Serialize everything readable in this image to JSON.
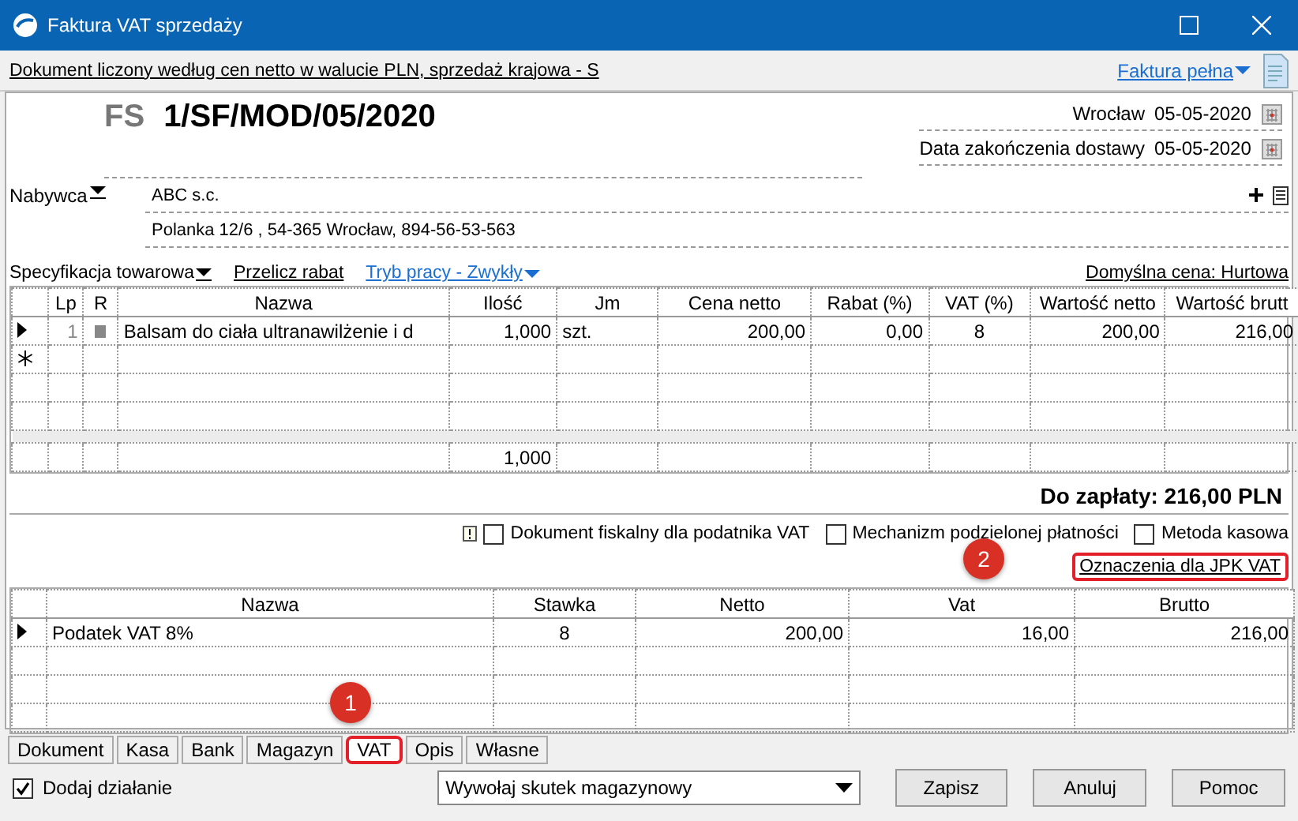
{
  "window": {
    "title": "Faktura VAT sprzedaży"
  },
  "info_bar": {
    "text": "Dokument liczony według cen netto w walucie PLN, sprzedaż krajowa - S",
    "invoice_type": "Faktura pełna"
  },
  "document": {
    "type": "FS",
    "number": "1/SF/MOD/05/2020",
    "place": "Wrocław",
    "issue_date": "05-05-2020",
    "delivery_label": "Data zakończenia dostawy",
    "delivery_date": "05-05-2020"
  },
  "buyer": {
    "label": "Nabywca",
    "name": "ABC s.c.",
    "address": "Polanka  12/6 , 54-365 Wrocław, 894-56-53-563"
  },
  "toolbar": {
    "specification": "Specyfikacja towarowa",
    "recalc": "Przelicz rabat",
    "mode": "Tryb pracy - Zwykły",
    "default_price": "Domyślna cena: Hurtowa"
  },
  "items_table": {
    "columns": [
      "Lp",
      "R",
      "Nazwa",
      "Ilość",
      "Jm",
      "Cena netto",
      "Rabat (%)",
      "VAT (%)",
      "Wartość netto",
      "Wartość brutt"
    ],
    "rows": [
      {
        "current": true,
        "cells": [
          "1",
          "",
          "Balsam do ciała ultranawilżenie i d",
          "1,000",
          "szt.",
          "200,00",
          "0,00",
          "8",
          "200,00",
          "216,00"
        ]
      }
    ],
    "totals": {
      "quantity": "1,000"
    }
  },
  "total": "Do zapłaty: 216,00 PLN",
  "options": [
    {
      "label": "Dokument fiskalny dla podatnika VAT",
      "checked": false,
      "kind": "noted"
    },
    {
      "label": "Mechanizm podzielonej płatności",
      "checked": false,
      "kind": "plain"
    },
    {
      "label": "Metoda kasowa",
      "checked": false,
      "kind": "plain"
    }
  ],
  "jpk_button": {
    "label": "Oznaczenia dla JPK VAT",
    "highlighted": true
  },
  "vat_table": {
    "columns": [
      "Nazwa",
      "Stawka",
      "Netto",
      "Vat",
      "Brutto"
    ],
    "rows": [
      {
        "current": true,
        "cells": [
          "Podatek VAT 8%",
          "8",
          "200,00",
          "16,00",
          "216,00"
        ]
      }
    ]
  },
  "tabs": [
    {
      "label": "Dokument",
      "selected": false,
      "highlighted": false
    },
    {
      "label": "Kasa",
      "selected": false,
      "highlighted": false
    },
    {
      "label": "Bank",
      "selected": false,
      "highlighted": false
    },
    {
      "label": "Magazyn",
      "selected": false,
      "highlighted": false
    },
    {
      "label": "VAT",
      "selected": true,
      "highlighted": true
    },
    {
      "label": "Opis",
      "selected": false,
      "highlighted": false
    },
    {
      "label": "Własne",
      "selected": false,
      "highlighted": false
    }
  ],
  "add_action": {
    "label": "Dodaj działanie",
    "checked": true
  },
  "warehouse_dropdown": {
    "value": "Wywołaj skutek magazynowy"
  },
  "buttons": [
    "Zapisz",
    "Anuluj",
    "Pomoc"
  ],
  "annotations": [
    {
      "label": "1"
    },
    {
      "label": "2"
    }
  ]
}
